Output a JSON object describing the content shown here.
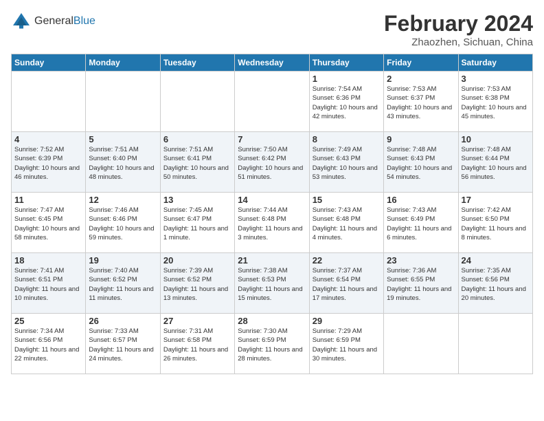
{
  "logo": {
    "general": "General",
    "blue": "Blue"
  },
  "header": {
    "title": "February 2024",
    "location": "Zhaozhen, Sichuan, China"
  },
  "weekdays": [
    "Sunday",
    "Monday",
    "Tuesday",
    "Wednesday",
    "Thursday",
    "Friday",
    "Saturday"
  ],
  "weeks": [
    [
      {
        "day": "",
        "info": ""
      },
      {
        "day": "",
        "info": ""
      },
      {
        "day": "",
        "info": ""
      },
      {
        "day": "",
        "info": ""
      },
      {
        "day": "1",
        "info": "Sunrise: 7:54 AM\nSunset: 6:36 PM\nDaylight: 10 hours\nand 42 minutes."
      },
      {
        "day": "2",
        "info": "Sunrise: 7:53 AM\nSunset: 6:37 PM\nDaylight: 10 hours\nand 43 minutes."
      },
      {
        "day": "3",
        "info": "Sunrise: 7:53 AM\nSunset: 6:38 PM\nDaylight: 10 hours\nand 45 minutes."
      }
    ],
    [
      {
        "day": "4",
        "info": "Sunrise: 7:52 AM\nSunset: 6:39 PM\nDaylight: 10 hours\nand 46 minutes."
      },
      {
        "day": "5",
        "info": "Sunrise: 7:51 AM\nSunset: 6:40 PM\nDaylight: 10 hours\nand 48 minutes."
      },
      {
        "day": "6",
        "info": "Sunrise: 7:51 AM\nSunset: 6:41 PM\nDaylight: 10 hours\nand 50 minutes."
      },
      {
        "day": "7",
        "info": "Sunrise: 7:50 AM\nSunset: 6:42 PM\nDaylight: 10 hours\nand 51 minutes."
      },
      {
        "day": "8",
        "info": "Sunrise: 7:49 AM\nSunset: 6:43 PM\nDaylight: 10 hours\nand 53 minutes."
      },
      {
        "day": "9",
        "info": "Sunrise: 7:48 AM\nSunset: 6:43 PM\nDaylight: 10 hours\nand 54 minutes."
      },
      {
        "day": "10",
        "info": "Sunrise: 7:48 AM\nSunset: 6:44 PM\nDaylight: 10 hours\nand 56 minutes."
      }
    ],
    [
      {
        "day": "11",
        "info": "Sunrise: 7:47 AM\nSunset: 6:45 PM\nDaylight: 10 hours\nand 58 minutes."
      },
      {
        "day": "12",
        "info": "Sunrise: 7:46 AM\nSunset: 6:46 PM\nDaylight: 10 hours\nand 59 minutes."
      },
      {
        "day": "13",
        "info": "Sunrise: 7:45 AM\nSunset: 6:47 PM\nDaylight: 11 hours\nand 1 minute."
      },
      {
        "day": "14",
        "info": "Sunrise: 7:44 AM\nSunset: 6:48 PM\nDaylight: 11 hours\nand 3 minutes."
      },
      {
        "day": "15",
        "info": "Sunrise: 7:43 AM\nSunset: 6:48 PM\nDaylight: 11 hours\nand 4 minutes."
      },
      {
        "day": "16",
        "info": "Sunrise: 7:43 AM\nSunset: 6:49 PM\nDaylight: 11 hours\nand 6 minutes."
      },
      {
        "day": "17",
        "info": "Sunrise: 7:42 AM\nSunset: 6:50 PM\nDaylight: 11 hours\nand 8 minutes."
      }
    ],
    [
      {
        "day": "18",
        "info": "Sunrise: 7:41 AM\nSunset: 6:51 PM\nDaylight: 11 hours\nand 10 minutes."
      },
      {
        "day": "19",
        "info": "Sunrise: 7:40 AM\nSunset: 6:52 PM\nDaylight: 11 hours\nand 11 minutes."
      },
      {
        "day": "20",
        "info": "Sunrise: 7:39 AM\nSunset: 6:52 PM\nDaylight: 11 hours\nand 13 minutes."
      },
      {
        "day": "21",
        "info": "Sunrise: 7:38 AM\nSunset: 6:53 PM\nDaylight: 11 hours\nand 15 minutes."
      },
      {
        "day": "22",
        "info": "Sunrise: 7:37 AM\nSunset: 6:54 PM\nDaylight: 11 hours\nand 17 minutes."
      },
      {
        "day": "23",
        "info": "Sunrise: 7:36 AM\nSunset: 6:55 PM\nDaylight: 11 hours\nand 19 minutes."
      },
      {
        "day": "24",
        "info": "Sunrise: 7:35 AM\nSunset: 6:56 PM\nDaylight: 11 hours\nand 20 minutes."
      }
    ],
    [
      {
        "day": "25",
        "info": "Sunrise: 7:34 AM\nSunset: 6:56 PM\nDaylight: 11 hours\nand 22 minutes."
      },
      {
        "day": "26",
        "info": "Sunrise: 7:33 AM\nSunset: 6:57 PM\nDaylight: 11 hours\nand 24 minutes."
      },
      {
        "day": "27",
        "info": "Sunrise: 7:31 AM\nSunset: 6:58 PM\nDaylight: 11 hours\nand 26 minutes."
      },
      {
        "day": "28",
        "info": "Sunrise: 7:30 AM\nSunset: 6:59 PM\nDaylight: 11 hours\nand 28 minutes."
      },
      {
        "day": "29",
        "info": "Sunrise: 7:29 AM\nSunset: 6:59 PM\nDaylight: 11 hours\nand 30 minutes."
      },
      {
        "day": "",
        "info": ""
      },
      {
        "day": "",
        "info": ""
      }
    ]
  ]
}
